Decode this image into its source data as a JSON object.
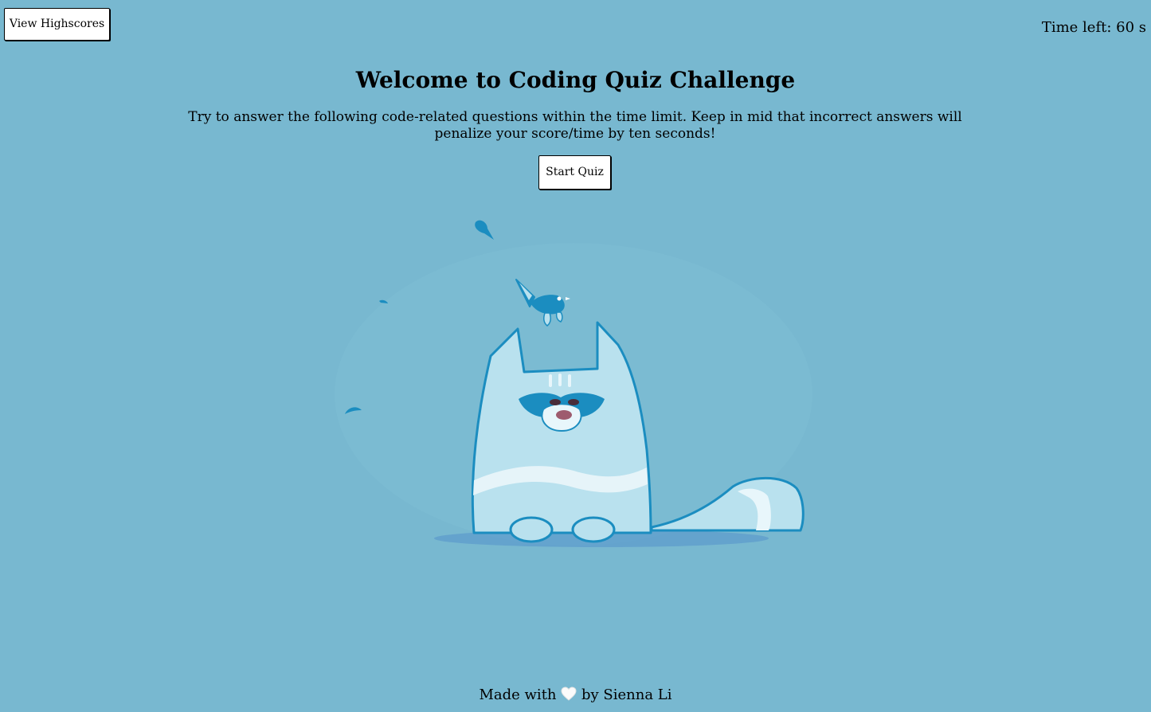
{
  "header": {
    "highscores_label": "View Highscores",
    "timer_text": "Time left: 60 s"
  },
  "intro": {
    "title": "Welcome to Coding Quiz Challenge",
    "description": "Try to answer the following code-related questions within the time limit. Keep in mid that incorrect answers will penalize your score/time by ten seconds!",
    "start_label": "Start Quiz"
  },
  "illustration": {
    "icon": "cat-with-bird-icon"
  },
  "footer": {
    "prefix": "Made with",
    "heart_icon": "white-heart-icon",
    "suffix": "by Sienna Li"
  },
  "colors": {
    "background": "#78b8d0",
    "button_bg": "#ffffff",
    "cat_outline": "#1b8dc0",
    "cat_fill": "#b9e1ee"
  }
}
